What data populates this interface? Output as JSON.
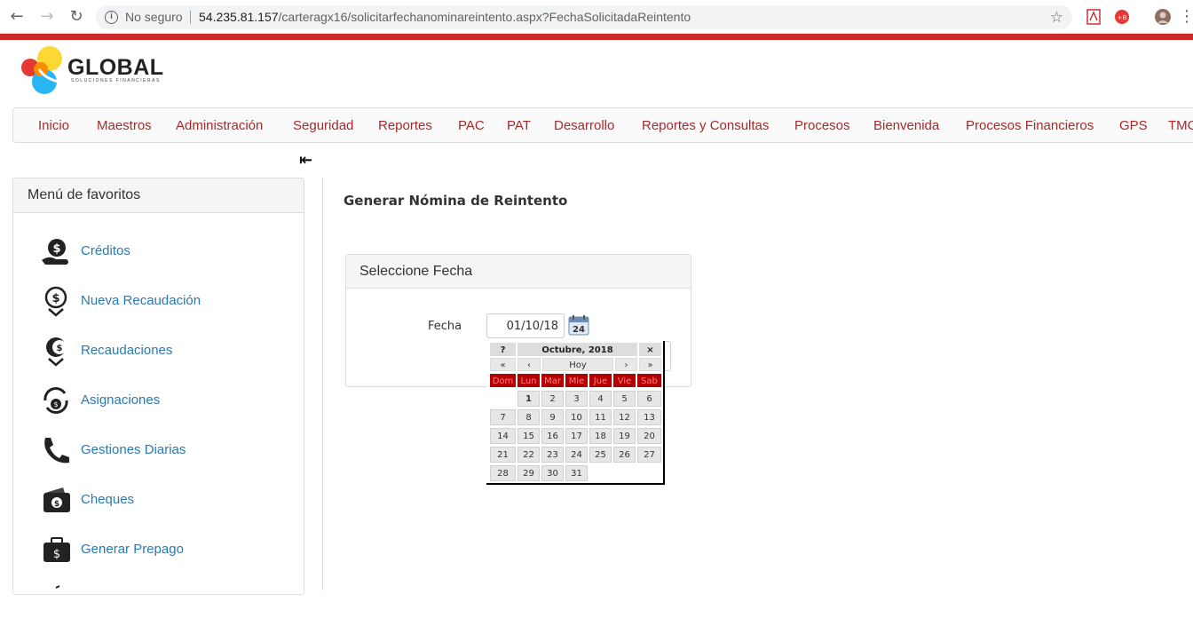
{
  "browser": {
    "security_label": "No seguro",
    "url_host": "54.235.81.157",
    "url_path": "/carteragx16/solicitarfechanominareintento.aspx?FechaSolicitadaReintento"
  },
  "logo": {
    "name": "GLOBAL",
    "tagline": "SOLUCIONES FINANCIERAS"
  },
  "topmenu": [
    {
      "label": "Inicio"
    },
    {
      "label": "Maestros"
    },
    {
      "label": "Administración"
    },
    {
      "label": "Seguridad"
    },
    {
      "label": "Reportes"
    },
    {
      "label": "PAC"
    },
    {
      "label": "PAT"
    },
    {
      "label": "Desarrollo"
    },
    {
      "label": "Reportes y Consultas"
    },
    {
      "label": "Procesos"
    },
    {
      "label": "Bienvenida"
    },
    {
      "label": "Procesos Financieros"
    },
    {
      "label": "GPS"
    },
    {
      "label": "TMC"
    }
  ],
  "favorites": {
    "title": "Menú de favoritos",
    "items": [
      {
        "label": "Créditos",
        "icon": "money-hand-icon"
      },
      {
        "label": "Nueva Recaudación",
        "icon": "money-down-icon"
      },
      {
        "label": "Recaudaciones",
        "icon": "coins-down-icon"
      },
      {
        "label": "Asignaciones",
        "icon": "refresh-money-icon"
      },
      {
        "label": "Gestiones Diarias",
        "icon": "phone-icon"
      },
      {
        "label": "Cheques",
        "icon": "wallet-icon"
      },
      {
        "label": "Generar Prepago",
        "icon": "briefcase-money-icon"
      }
    ]
  },
  "main": {
    "title": "Generar Nómina de Reintento",
    "panel_title": "Seleccione Fecha",
    "fecha_label": "Fecha",
    "fecha_value": "01/10/18"
  },
  "calendar": {
    "help": "?",
    "month_title": "Octubre, 2018",
    "close": "×",
    "prev_year": "«",
    "prev_month": "‹",
    "today": "Hoy",
    "next_month": "›",
    "next_year": "»",
    "day_names": [
      "Dom",
      "Lun",
      "Mar",
      "Mie",
      "Jue",
      "Vie",
      "Sab"
    ],
    "weeks": [
      [
        "",
        "1",
        "2",
        "3",
        "4",
        "5",
        "6"
      ],
      [
        "7",
        "8",
        "9",
        "10",
        "11",
        "12",
        "13"
      ],
      [
        "14",
        "15",
        "16",
        "17",
        "18",
        "19",
        "20"
      ],
      [
        "21",
        "22",
        "23",
        "24",
        "25",
        "26",
        "27"
      ],
      [
        "28",
        "29",
        "30",
        "31",
        "",
        "",
        ""
      ]
    ],
    "selected_day": "1"
  },
  "colors": {
    "menu_text": "#a52a2a",
    "brand_red": "#cc2a2a",
    "link_blue": "#2c78b0",
    "calendar_header": "#b40000"
  }
}
